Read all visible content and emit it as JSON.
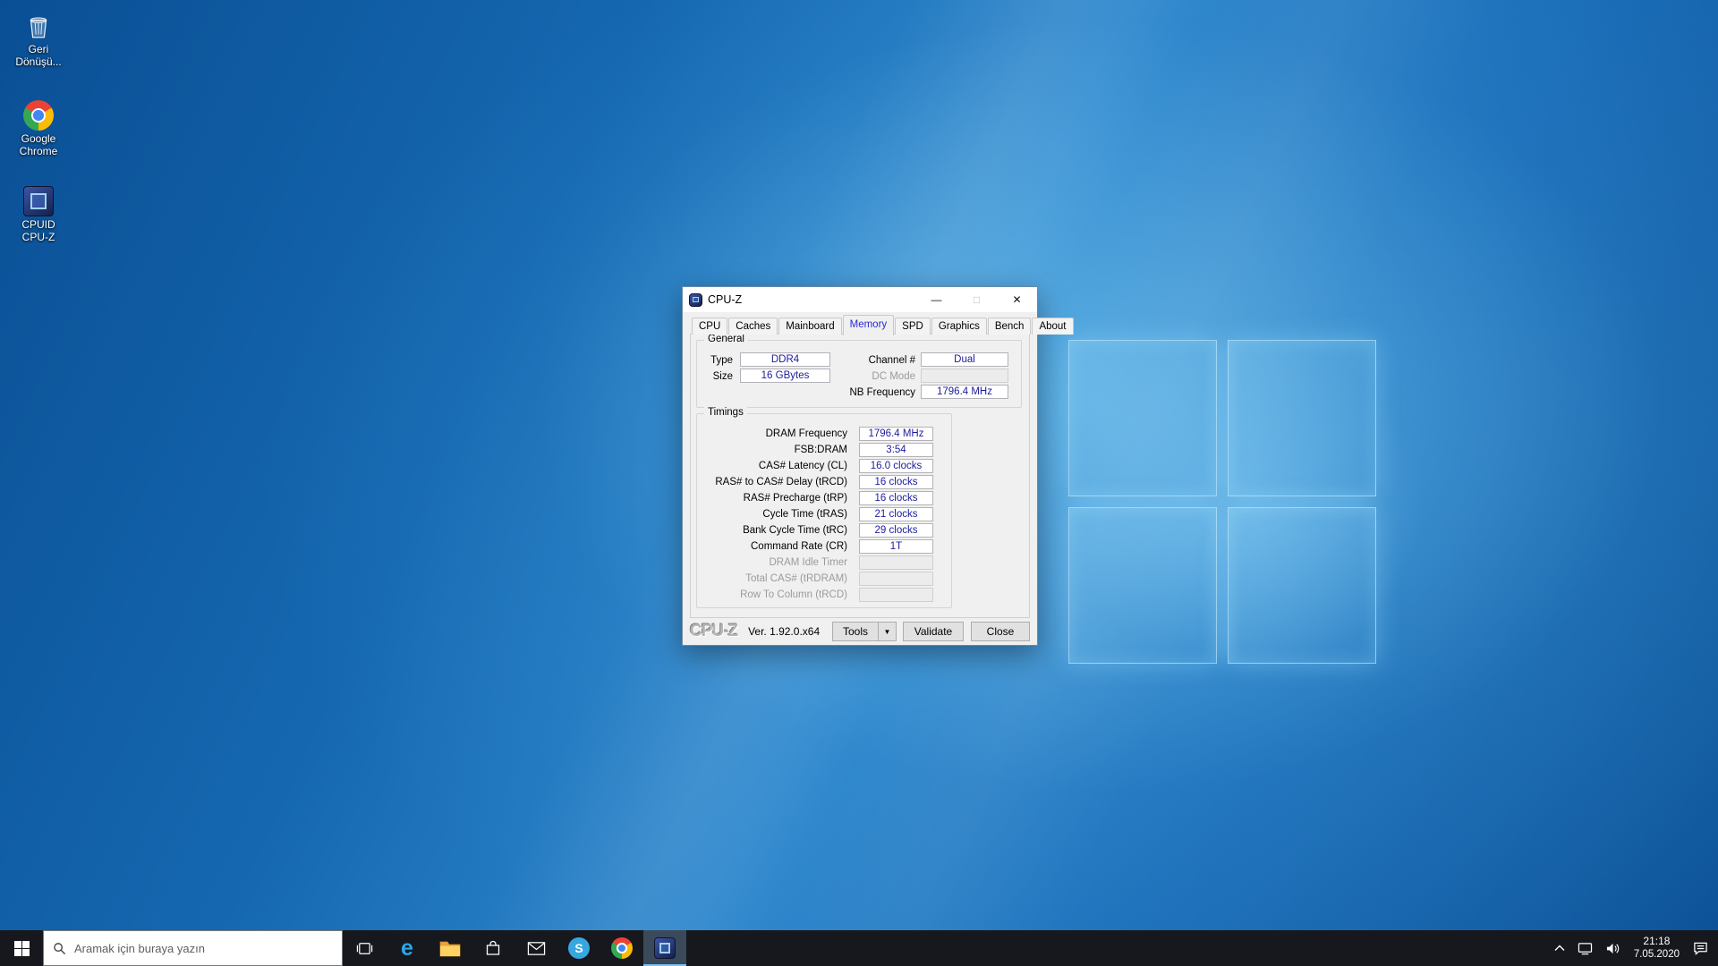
{
  "desktop_icons": [
    {
      "name": "recycle-bin",
      "label": "Geri Dönüşü..."
    },
    {
      "name": "google-chrome",
      "label": "Google Chrome"
    },
    {
      "name": "cpuid-cpuz",
      "label": "CPUID CPU-Z"
    }
  ],
  "cpuz": {
    "title": "CPU-Z",
    "controls": {
      "minimize": "—",
      "maximize": "□",
      "close": "✕"
    },
    "tabs": [
      "CPU",
      "Caches",
      "Mainboard",
      "Memory",
      "SPD",
      "Graphics",
      "Bench",
      "About"
    ],
    "selected_tab": "Memory",
    "general": {
      "title": "General",
      "type_label": "Type",
      "type_value": "DDR4",
      "size_label": "Size",
      "size_value": "16 GBytes",
      "channel_label": "Channel #",
      "channel_value": "Dual",
      "dc_mode_label": "DC Mode",
      "dc_mode_value": "",
      "nb_freq_label": "NB Frequency",
      "nb_freq_value": "1796.4 MHz"
    },
    "timings": {
      "title": "Timings",
      "rows": [
        {
          "label": "DRAM Frequency",
          "value": "1796.4 MHz"
        },
        {
          "label": "FSB:DRAM",
          "value": "3:54"
        },
        {
          "label": "CAS# Latency (CL)",
          "value": "16.0 clocks"
        },
        {
          "label": "RAS# to CAS# Delay (tRCD)",
          "value": "16 clocks"
        },
        {
          "label": "RAS# Precharge (tRP)",
          "value": "16 clocks"
        },
        {
          "label": "Cycle Time (tRAS)",
          "value": "21 clocks"
        },
        {
          "label": "Bank Cycle Time (tRC)",
          "value": "29 clocks"
        },
        {
          "label": "Command Rate (CR)",
          "value": "1T"
        },
        {
          "label": "DRAM Idle Timer",
          "value": ""
        },
        {
          "label": "Total CAS# (tRDRAM)",
          "value": ""
        },
        {
          "label": "Row To Column (tRCD)",
          "value": ""
        }
      ]
    },
    "footer": {
      "logo": "CPU-Z",
      "version": "Ver. 1.92.0.x64",
      "tools": "Tools",
      "tools_arrow": "▼",
      "validate": "Validate",
      "close": "Close"
    }
  },
  "taskbar": {
    "search_placeholder": "Aramak için buraya yazın",
    "icons": [
      "start",
      "task-view",
      "edge",
      "file-explorer",
      "store",
      "mail",
      "skype",
      "chrome",
      "cpuz"
    ],
    "edge_glyph": "e",
    "skype_glyph": "S",
    "time": "21:18",
    "date": "7.05.2020"
  }
}
